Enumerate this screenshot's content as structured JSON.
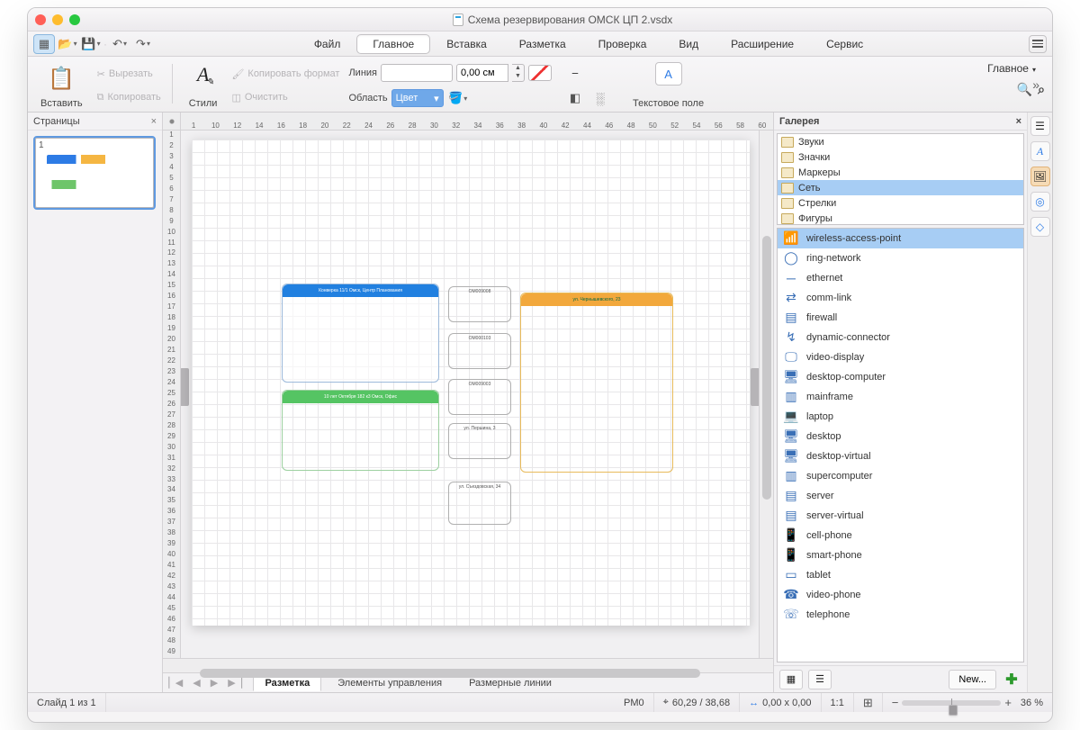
{
  "title": "Схема резервирования ОМСК ЦП 2.vsdx",
  "menu": {
    "items": [
      "Файл",
      "Главное",
      "Вставка",
      "Разметка",
      "Проверка",
      "Вид",
      "Расширение",
      "Сервис"
    ],
    "active": "Главное"
  },
  "ribbon": {
    "paste": "Вставить",
    "cut": "Вырезать",
    "copy": "Копировать",
    "styles": "Стили",
    "copy_format": "Копировать формат",
    "clear": "Очистить",
    "line_label": "Линия",
    "line_width": "0,00 см",
    "area_label": "Область",
    "color_label": "Цвет",
    "textbox": "Текстовое поле",
    "right_tab": "Главное"
  },
  "pages": {
    "title": "Страницы"
  },
  "ruler_h": [
    "1",
    "10",
    "12",
    "14",
    "16",
    "18",
    "20",
    "22",
    "24",
    "26",
    "28",
    "30",
    "32",
    "34",
    "36",
    "38",
    "40",
    "42",
    "44",
    "46",
    "48",
    "50",
    "52",
    "54",
    "56",
    "58",
    "60"
  ],
  "ruler_v": [
    "1",
    "2",
    "3",
    "4",
    "5",
    "6",
    "7",
    "8",
    "9",
    "10",
    "11",
    "12",
    "13",
    "14",
    "15",
    "16",
    "17",
    "18",
    "19",
    "20",
    "21",
    "22",
    "23",
    "24",
    "25",
    "26",
    "27",
    "28",
    "29",
    "30",
    "31",
    "32",
    "33",
    "34",
    "35",
    "36",
    "37",
    "38",
    "39",
    "40",
    "41",
    "42",
    "43",
    "44",
    "45",
    "46",
    "47",
    "48",
    "49"
  ],
  "diagram": {
    "block_a": "Конверка 11/1 Омск, Центр Планования",
    "block_b": "10 лет Октября 182 к3 Омск, Офис",
    "block_c": "ул. Чернышевского, 23",
    "mid1": "OM009008",
    "mid2": "OM000103",
    "mid3": "OM009003",
    "mid4": "ул. Першина, 3",
    "mid5": "ул. Съездовская, 34"
  },
  "sheets": {
    "s1": "Разметка",
    "s2": "Элементы управления",
    "s3": "Размерные линии"
  },
  "gallery": {
    "title": "Галерея",
    "categories": [
      "Звуки",
      "Значки",
      "Маркеры",
      "Сеть",
      "Стрелки",
      "Фигуры"
    ],
    "selected_category": "Сеть",
    "shapes": [
      "wireless-access-point",
      "ring-network",
      "ethernet",
      "comm-link",
      "firewall",
      "dynamic-connector",
      "video-display",
      "desktop-computer",
      "mainframe",
      "laptop",
      "desktop",
      "desktop-virtual",
      "supercomputer",
      "server",
      "server-virtual",
      "cell-phone",
      "smart-phone",
      "tablet",
      "video-phone",
      "telephone"
    ],
    "selected_shape": "wireless-access-point",
    "new_btn": "New..."
  },
  "status": {
    "slide": "Слайд 1 из 1",
    "pm": "PM0",
    "coords": "60,29 / 38,68",
    "size": "0,00 x 0,00",
    "scale": "1:1",
    "zoom": "36 %"
  }
}
